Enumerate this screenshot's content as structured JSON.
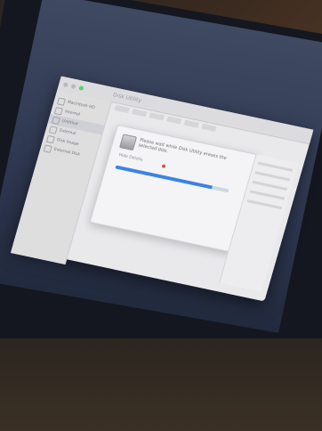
{
  "window": {
    "title": "Disk Utility"
  },
  "sidebar": {
    "items": [
      {
        "label": "Macintosh HD",
        "active": false
      },
      {
        "label": "Internal",
        "active": false
      },
      {
        "label": "Untitled",
        "active": true
      },
      {
        "label": "External",
        "active": false
      },
      {
        "label": "Disk Image",
        "active": false
      },
      {
        "label": "External Disk",
        "active": false
      }
    ]
  },
  "dialog": {
    "message": "Please wait while Disk Utility erases the selected disk.",
    "detail_label": "Hide Details",
    "progress": 0.85
  },
  "colors": {
    "accent": "#3b82e6",
    "stop": "#d9534f"
  }
}
